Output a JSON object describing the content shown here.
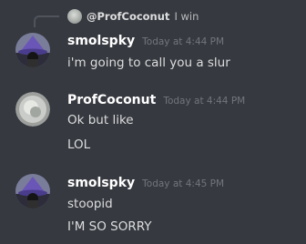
{
  "reply": {
    "mention": "@ProfCoconut",
    "text": "I win",
    "avatar_icon": "coin-avatar-icon"
  },
  "messages": [
    {
      "username": "smolspky",
      "timestamp": "Today at 4:44 PM",
      "lines": [
        "i'm going to call you a slur"
      ],
      "avatar_icon": "wizard-avatar-icon"
    },
    {
      "username": "ProfCoconut",
      "timestamp": "Today at 4:44 PM",
      "lines": [
        "Ok but like",
        "LOL"
      ],
      "avatar_icon": "coin-avatar-icon"
    },
    {
      "username": "smolspky",
      "timestamp": "Today at 4:45 PM",
      "lines": [
        "stoopid",
        "I'M SO SORRY"
      ],
      "avatar_icon": "wizard-avatar-icon"
    }
  ],
  "colors": {
    "background": "#36393f",
    "username": "#ffffff",
    "text": "#dcddde",
    "timestamp": "#72767d"
  }
}
